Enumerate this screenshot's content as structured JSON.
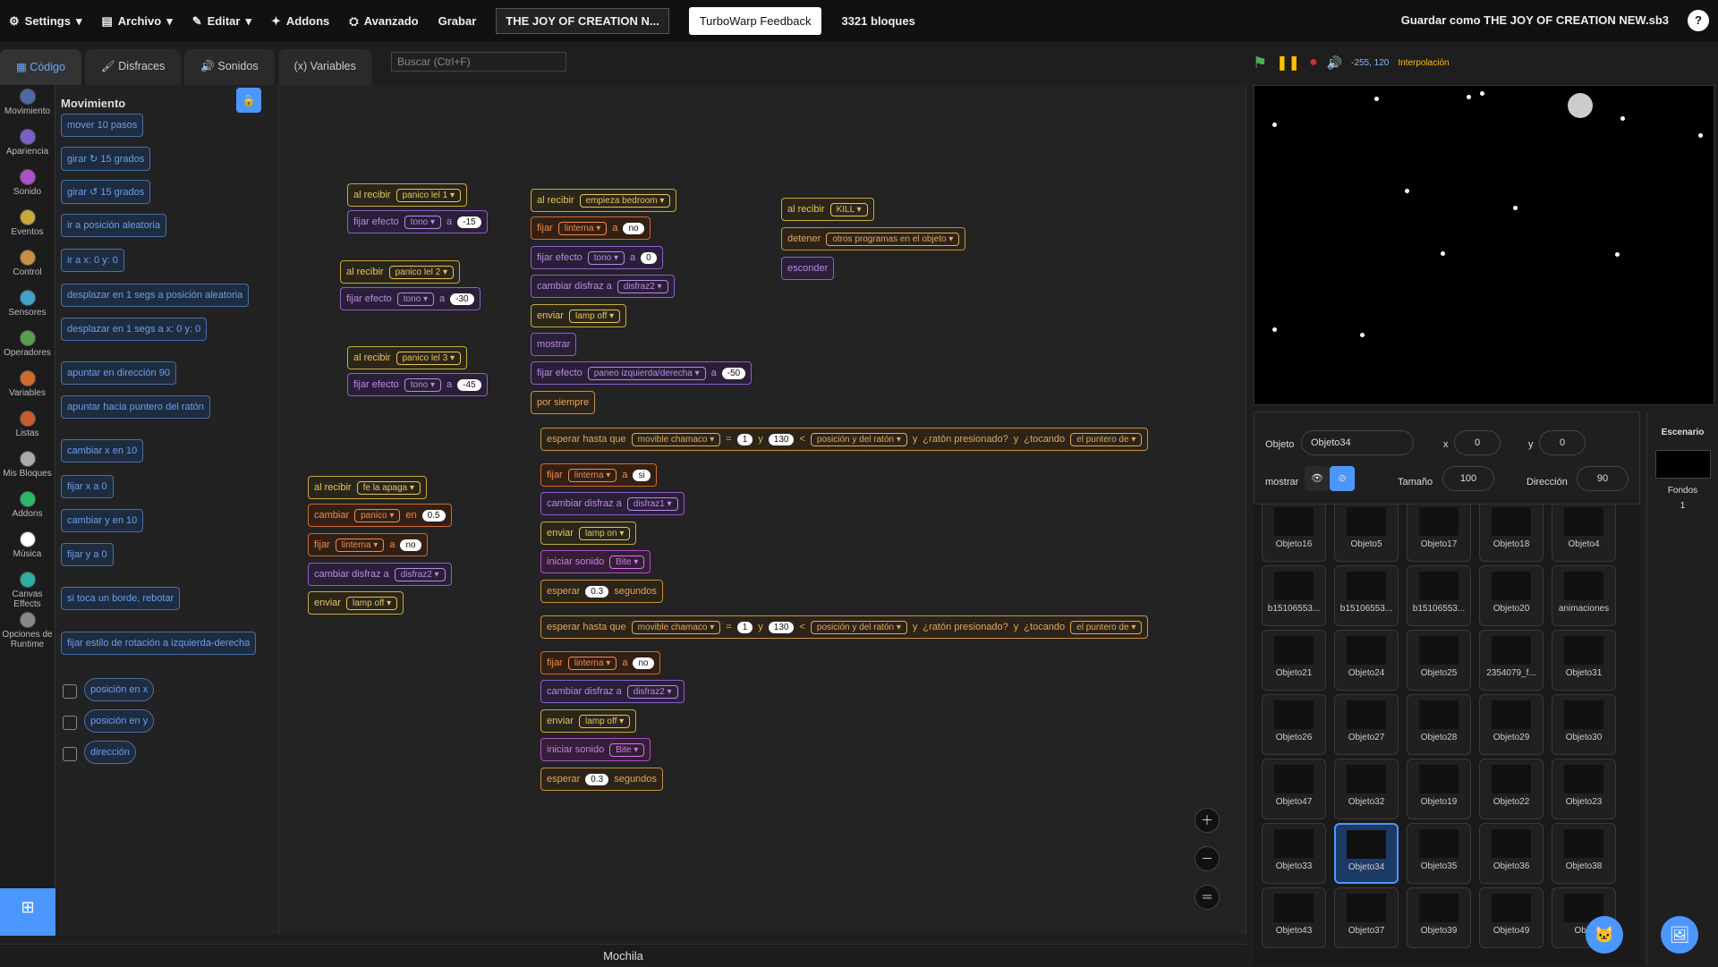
{
  "menu": {
    "settings": "Settings",
    "file": "Archivo",
    "edit": "Editar",
    "addons": "Addons",
    "advanced": "Avanzado",
    "record": "Grabar",
    "project_title": "THE JOY OF CREATION N...",
    "feedback": "TurboWarp Feedback",
    "blocks": "3321 bloques",
    "save_as": "Guardar como THE JOY OF CREATION NEW.sb3",
    "help": "?"
  },
  "tabs": {
    "code": "Código",
    "costumes": "Disfraces",
    "sounds": "Sonidos",
    "variables": "Variables"
  },
  "search_placeholder": "Buscar (Ctrl+F)",
  "categories": [
    {
      "label": "Movimiento",
      "color": "#4c6aa8"
    },
    {
      "label": "Apariencia",
      "color": "#7a5fc7"
    },
    {
      "label": "Sonido",
      "color": "#b04fc8"
    },
    {
      "label": "Eventos",
      "color": "#c9a83d"
    },
    {
      "label": "Control",
      "color": "#c89040"
    },
    {
      "label": "Sensores",
      "color": "#3ea3c6"
    },
    {
      "label": "Operadores",
      "color": "#58a04c"
    },
    {
      "label": "Variables",
      "color": "#d26a2c"
    },
    {
      "label": "Listas",
      "color": "#c85a2c"
    },
    {
      "label": "Mis Bloques",
      "color": "#aaaaaa"
    },
    {
      "label": "Addons",
      "color": "#29b86a"
    },
    {
      "label": "Música",
      "color": "#ffffff"
    },
    {
      "label": "Canvas Effects",
      "color": "#2ab0a0"
    },
    {
      "label": "Opciones de Runtime",
      "color": "#888888"
    }
  ],
  "palette": {
    "title": "Movimiento",
    "blocks": [
      "mover 10 pasos",
      "girar ↻ 15 grados",
      "girar ↺ 15 grados",
      "ir a posición aleatoria",
      "ir a x: 0 y: 0",
      "desplazar en 1 segs a posición aleatoria",
      "desplazar en 1 segs a x: 0 y: 0",
      "apuntar en dirección 90",
      "apuntar hacia puntero del ratón",
      "cambiar x en 10",
      "fijar x a 0",
      "cambiar y en 10",
      "fijar y a 0",
      "si toca un borde, rebotar",
      "fijar estilo de rotación a izquierda-derecha"
    ],
    "reporters": [
      "posición en x",
      "posición en y",
      "dirección"
    ]
  },
  "canvas": {
    "s1": [
      "al recibir",
      "panico lel 1",
      "fijar efecto",
      "tono",
      "a",
      "-15"
    ],
    "s2": [
      "al recibir",
      "panico lel 2",
      "fijar efecto",
      "tono",
      "a",
      "-30"
    ],
    "s3": [
      "al recibir",
      "panico lel 3",
      "fijar efecto",
      "tono",
      "a",
      "-45"
    ],
    "s4": [
      "al recibir",
      "fe la apaga",
      "cambiar",
      "panico",
      "en",
      "0.5",
      "fijar",
      "linterna",
      "a",
      "no",
      "cambiar disfraz a",
      "disfraz2",
      "enviar",
      "lamp off"
    ],
    "s5": [
      "al recibir",
      "empieza bedroom",
      "fijar",
      "linterna",
      "a",
      "no",
      "fijar efecto",
      "tono",
      "a",
      "0",
      "cambiar disfraz a",
      "disfraz2",
      "enviar",
      "lamp off",
      "mostrar",
      "fijar efecto",
      "paneo izquierda/derecha",
      "a",
      "-50",
      "por siempre"
    ],
    "loop": [
      "esperar hasta que",
      "movible chamaco",
      "=",
      "1",
      "y",
      "130",
      "<",
      "posición y del ratón",
      "y",
      "¿ratón presionado?",
      "y",
      "¿tocando",
      "el puntero de"
    ],
    "loop_a": [
      "fijar",
      "linterna",
      "a",
      "si",
      "cambiar disfraz a",
      "disfraz1",
      "enviar",
      "lamp on",
      "iniciar sonido",
      "Bite",
      "esperar",
      "0.3",
      "segundos"
    ],
    "loop_b": [
      "fijar",
      "linterna",
      "a",
      "no",
      "cambiar disfraz a",
      "disfraz2",
      "enviar",
      "lamp off",
      "iniciar sonido",
      "Bite",
      "esperar",
      "0.3",
      "segundos"
    ],
    "s6": [
      "al recibir",
      "KILL",
      "detener",
      "otros programas en el objeto",
      "esconder"
    ]
  },
  "stage": {
    "coords": "-255, 120",
    "interp": "Interpolación"
  },
  "sprite": {
    "label_obj": "Objeto",
    "name": "Objeto34",
    "x_label": "x",
    "x": "0",
    "y_label": "y",
    "y": "0",
    "show": "mostrar",
    "size_label": "Tamaño",
    "size": "100",
    "dir_label": "Dirección",
    "dir": "90"
  },
  "sprites": [
    "Objeto16",
    "Objeto5",
    "Objeto17",
    "Objeto18",
    "Objeto4",
    "b15106553...",
    "b15106553...",
    "b15106553...",
    "Objeto20",
    "animaciones",
    "Objeto21",
    "Objeto24",
    "Objeto25",
    "2354079_f...",
    "Objeto31",
    "Objeto26",
    "Objeto27",
    "Objeto28",
    "Objeto29",
    "Objeto30",
    "Objeto47",
    "Objeto32",
    "Objeto19",
    "Objeto22",
    "Objeto23",
    "Objeto33",
    "Objeto34",
    "Objeto35",
    "Objeto36",
    "Objeto38",
    "Objeto43",
    "Objeto37",
    "Objeto39",
    "Objeto49",
    "Obje"
  ],
  "selected_sprite": "Objeto34",
  "scenario": {
    "title": "Escenario",
    "backdrops": "Fondos",
    "count": "1"
  },
  "backpack": "Mochila"
}
